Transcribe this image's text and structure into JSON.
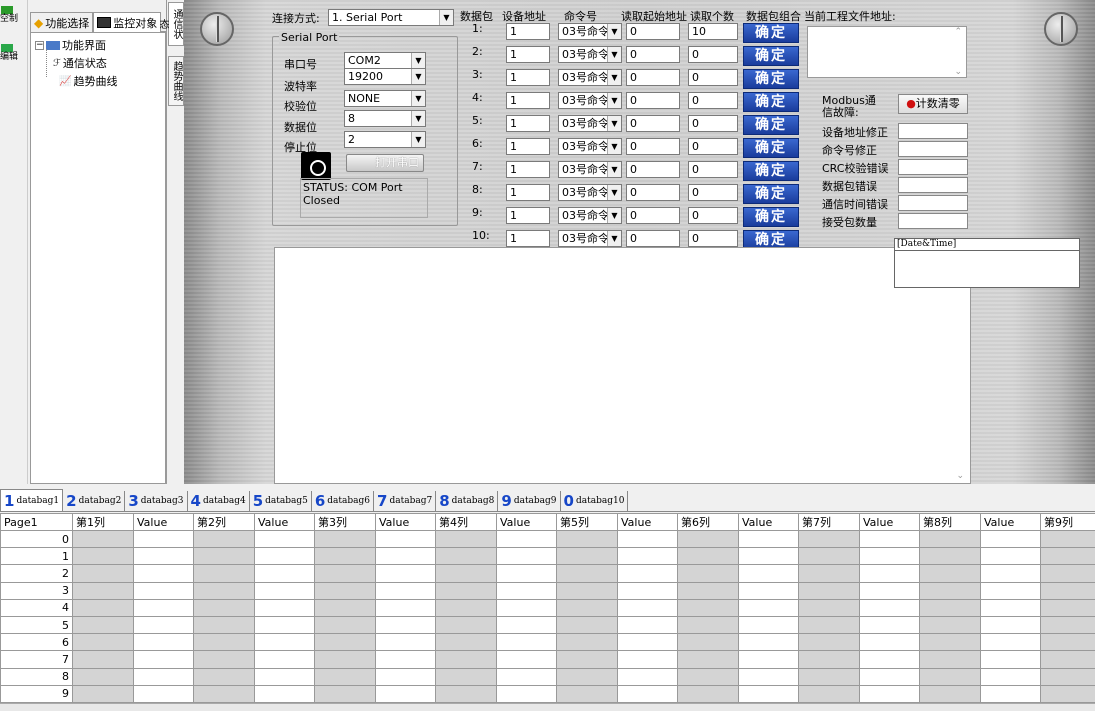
{
  "left_strip": {
    "items": [
      "空制",
      "编辑"
    ]
  },
  "tree": {
    "tabs": [
      "功能选择",
      "监控对象"
    ],
    "root": "功能界面",
    "children": [
      "通信状态",
      "趋势曲线"
    ]
  },
  "vertical_tabs": [
    "通信状态",
    "趋势曲线"
  ],
  "connection": {
    "label": "连接方式:",
    "value": "1. Serial Port"
  },
  "serial": {
    "group_title": "Serial Port",
    "fields": [
      {
        "label": "串口号",
        "value": "COM2"
      },
      {
        "label": "波特率",
        "value": "19200"
      },
      {
        "label": "校验位",
        "value": "NONE"
      },
      {
        "label": "数据位",
        "value": "8"
      },
      {
        "label": "停止位",
        "value": "2"
      }
    ],
    "open_button": "打开串口",
    "status": "STATUS: COM Port Closed"
  },
  "packets": {
    "headers": [
      "数据包",
      "设备地址",
      "命令号",
      "读取起始地址",
      "读取个数",
      "数据包组合"
    ],
    "confirm_label": "确定",
    "rows": [
      {
        "no": "1:",
        "addr": "1",
        "cmd": "03号命令",
        "start": "0",
        "count": "10"
      },
      {
        "no": "2:",
        "addr": "1",
        "cmd": "03号命令",
        "start": "0",
        "count": "0"
      },
      {
        "no": "3:",
        "addr": "1",
        "cmd": "03号命令",
        "start": "0",
        "count": "0"
      },
      {
        "no": "4:",
        "addr": "1",
        "cmd": "03号命令",
        "start": "0",
        "count": "0"
      },
      {
        "no": "5:",
        "addr": "1",
        "cmd": "03号命令",
        "start": "0",
        "count": "0"
      },
      {
        "no": "6:",
        "addr": "1",
        "cmd": "03号命令",
        "start": "0",
        "count": "0"
      },
      {
        "no": "7:",
        "addr": "1",
        "cmd": "03号命令",
        "start": "0",
        "count": "0"
      },
      {
        "no": "8:",
        "addr": "1",
        "cmd": "03号命令",
        "start": "0",
        "count": "0"
      },
      {
        "no": "9:",
        "addr": "1",
        "cmd": "03号命令",
        "start": "0",
        "count": "0"
      },
      {
        "no": "10:",
        "addr": "1",
        "cmd": "03号命令",
        "start": "0",
        "count": "0"
      }
    ]
  },
  "project": {
    "label": "当前工程文件地址:"
  },
  "modbus": {
    "fault_label": "Modbus通信故障:",
    "clear_button": "计数清零",
    "errors": [
      "设备地址修正",
      "命令号修正",
      "CRC校验错误",
      "数据包错误",
      "通信时间错误",
      "接受包数量"
    ]
  },
  "datetime_header": "[Date&Time]",
  "databags": [
    {
      "num": "1",
      "label": "databag1"
    },
    {
      "num": "2",
      "label": "databag2"
    },
    {
      "num": "3",
      "label": "databag3"
    },
    {
      "num": "4",
      "label": "databag4"
    },
    {
      "num": "5",
      "label": "databag5"
    },
    {
      "num": "6",
      "label": "databag6"
    },
    {
      "num": "7",
      "label": "databag7"
    },
    {
      "num": "8",
      "label": "databag8"
    },
    {
      "num": "9",
      "label": "databag9"
    },
    {
      "num": "0",
      "label": "databag10"
    }
  ],
  "grid": {
    "corner": "Page1",
    "columns": [
      "第1列",
      "Value",
      "第2列",
      "Value",
      "第3列",
      "Value",
      "第4列",
      "Value",
      "第5列",
      "Value",
      "第6列",
      "Value",
      "第7列",
      "Value",
      "第8列",
      "Value",
      "第9列"
    ],
    "rows": [
      "0",
      "1",
      "2",
      "3",
      "4",
      "5",
      "6",
      "7",
      "8",
      "9"
    ]
  },
  "colors": {
    "confirm_button": "#1f45a8",
    "tab_number": "#1747c8",
    "grid_shade": "#d4d4d4"
  }
}
